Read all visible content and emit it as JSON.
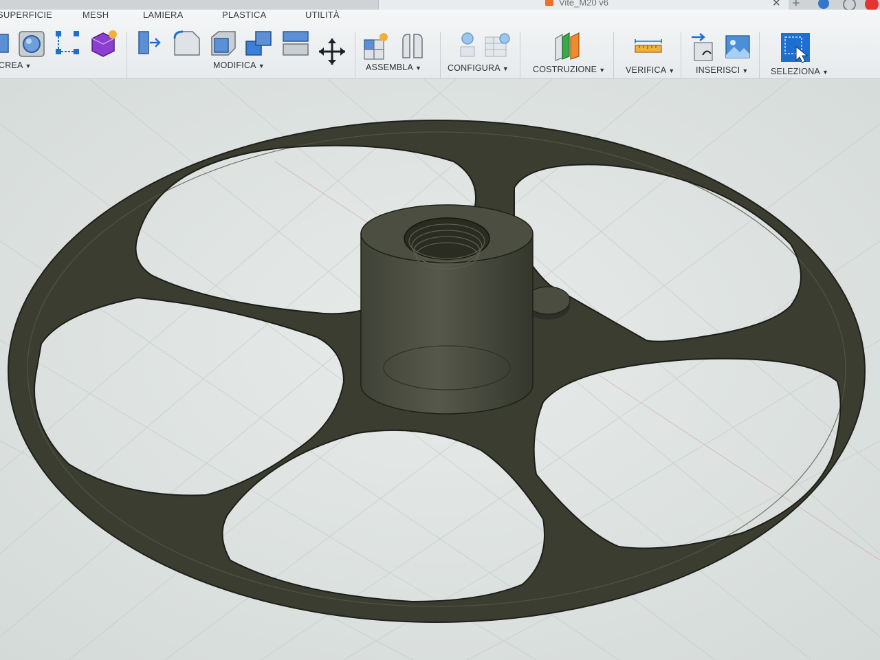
{
  "window": {
    "document_title": "Vite_M20 v6"
  },
  "toolbar": {
    "tabs": [
      "SUPERFICIE",
      "MESH",
      "LAMIERA",
      "PLASTICA",
      "UTILITÀ"
    ],
    "groups": {
      "crea": "CREA",
      "modifica": "MODIFICA",
      "assembla": "ASSEMBLA",
      "configura": "CONFIGURA",
      "costruzione": "COSTRUZIONE",
      "verifica": "VERIFICA",
      "inserisci": "INSERISCI",
      "seleziona": "SELEZIONA"
    }
  },
  "colors": {
    "accent": "#1f6fd1",
    "model": "#3b3d31",
    "canvas": "#dde2e0"
  },
  "icons": [
    "box-icon",
    "sphere-icon",
    "sketch-pattern-icon",
    "form-icon",
    "press-pull-icon",
    "fillet-icon",
    "shell-icon",
    "combine-icon",
    "replace-face-icon",
    "move-icon",
    "new-component-icon",
    "joint-icon",
    "parameters-icon",
    "configure-table-icon",
    "offset-plane-icon",
    "measure-icon",
    "insert-derive-icon",
    "insert-image-icon",
    "select-icon"
  ]
}
